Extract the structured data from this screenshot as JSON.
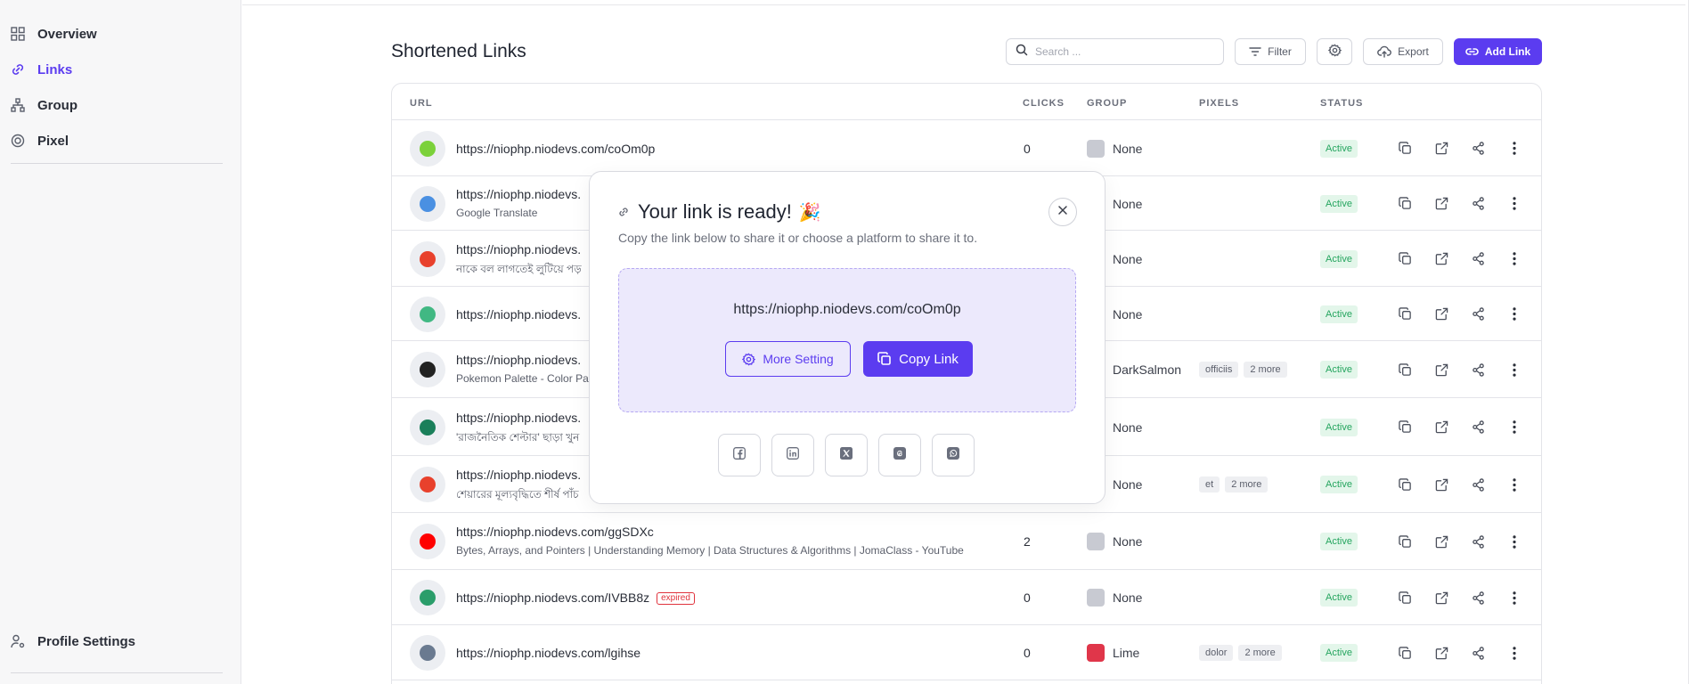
{
  "sidebar": {
    "items": [
      {
        "label": "Overview",
        "icon": "grid-icon",
        "active": false
      },
      {
        "label": "Links",
        "icon": "link-icon",
        "active": true
      },
      {
        "label": "Group",
        "icon": "hierarchy-icon",
        "active": false
      },
      {
        "label": "Pixel",
        "icon": "target-icon",
        "active": false
      }
    ],
    "profile_label": "Profile Settings"
  },
  "page": {
    "title": "Shortened Links",
    "search_placeholder": "Search ...",
    "filter_label": "Filter",
    "export_label": "Export",
    "add_label": "Add Link"
  },
  "table": {
    "headers": {
      "url": "URL",
      "clicks": "CLICKS",
      "group": "GROUP",
      "pixels": "PIXELS",
      "status": "STATUS"
    },
    "rows": [
      {
        "url": "https://niophp.niodevs.com/coOm0p",
        "sub": "",
        "clicks": "0",
        "group": "None",
        "group_color": "#c8cad2",
        "pixels": [],
        "status": "Active",
        "expired": ""
      },
      {
        "url": "https://niophp.niodevs.",
        "sub": "Google Translate",
        "clicks": "",
        "group": "None",
        "group_color": "#c8cad2",
        "pixels": [],
        "status": "Active",
        "expired": ""
      },
      {
        "url": "https://niophp.niodevs.",
        "sub": "নাকে বল লাগতেই লুটিয়ে পড়",
        "clicks": "",
        "group": "None",
        "group_color": "#c8cad2",
        "pixels": [],
        "status": "Active",
        "expired": ""
      },
      {
        "url": "https://niophp.niodevs.",
        "sub": "",
        "clicks": "",
        "group": "None",
        "group_color": "#c8cad2",
        "pixels": [],
        "status": "Active",
        "expired": ""
      },
      {
        "url": "https://niophp.niodevs.",
        "sub": "Pokemon Palette - Color Pa",
        "clicks": "",
        "group": "DarkSalmon",
        "group_color": "#e9967a",
        "pixels": [
          "officiis",
          "2 more"
        ],
        "status": "Active",
        "expired": ""
      },
      {
        "url": "https://niophp.niodevs.",
        "sub": "'রাজনৈতিক শেল্টার' ছাড়া খুন",
        "clicks": "",
        "group": "None",
        "group_color": "#c8cad2",
        "pixels": [],
        "status": "Active",
        "expired": ""
      },
      {
        "url": "https://niophp.niodevs.",
        "sub": "শেয়ারের মূল্যবৃদ্ধিতে শীর্ষ পাঁচ",
        "clicks": "",
        "group": "None",
        "group_color": "#c8cad2",
        "pixels": [
          "et",
          "2 more"
        ],
        "status": "Active",
        "expired": ""
      },
      {
        "url": "https://niophp.niodevs.com/ggSDXc",
        "sub": "Bytes, Arrays, and Pointers | Understanding Memory | Data Structures & Algorithms | JomaClass - YouTube",
        "clicks": "2",
        "group": "None",
        "group_color": "#c8cad2",
        "pixels": [],
        "status": "Active",
        "expired": ""
      },
      {
        "url": "https://niophp.niodevs.com/IVBB8z",
        "sub": "",
        "clicks": "0",
        "group": "None",
        "group_color": "#c8cad2",
        "pixels": [],
        "status": "Active",
        "expired": "expired"
      },
      {
        "url": "https://niophp.niodevs.com/lgihse",
        "sub": "",
        "clicks": "0",
        "group": "Lime",
        "group_color": "#e0364a",
        "pixels": [
          "dolor",
          "2 more"
        ],
        "status": "Active",
        "expired": ""
      }
    ]
  },
  "modal": {
    "title": "Your link is ready!",
    "emoji": "🎉",
    "description": "Copy the link below to share it or choose a platform to share it to.",
    "link": "https://niophp.niodevs.com/coOm0p",
    "more_setting_label": "More Setting",
    "copy_label": "Copy Link",
    "share_platforms": [
      "facebook-icon",
      "linkedin-icon",
      "x-icon",
      "threads-icon",
      "whatsapp-icon"
    ]
  },
  "colors": {
    "accent": "#5b3cf0",
    "active_green": "#25a55f",
    "expired_red": "#e0323c"
  }
}
